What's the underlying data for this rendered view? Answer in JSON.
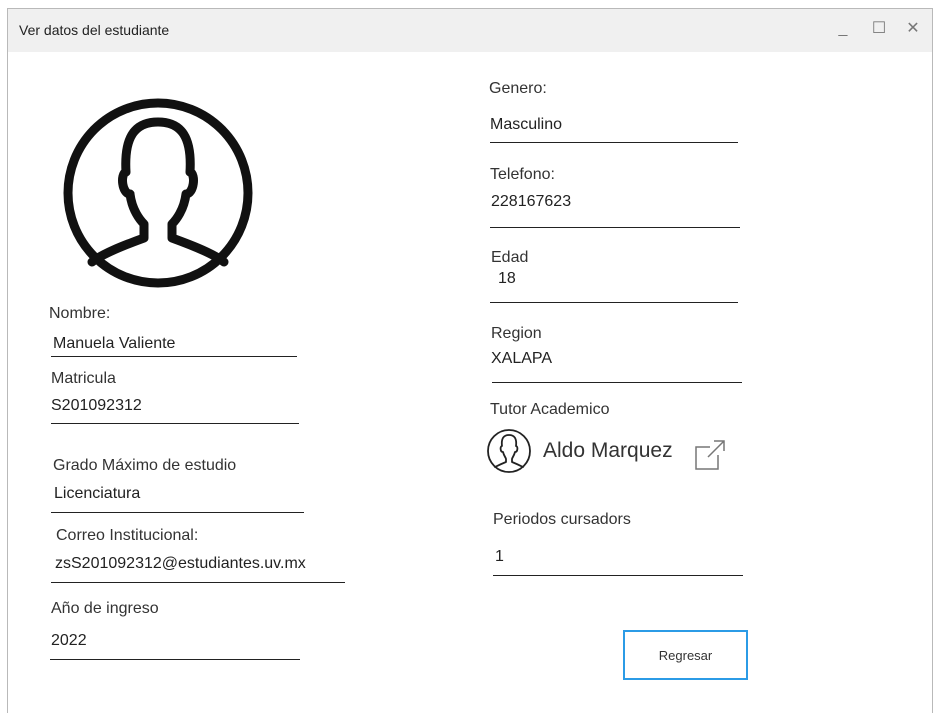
{
  "window": {
    "title": "Ver datos del estudiante",
    "minimize": "_",
    "maximize": "☐",
    "close": "✕"
  },
  "fields": {
    "nombre": {
      "label": "Nombre:",
      "value": "Manuela Valiente"
    },
    "matricula": {
      "label": "Matricula",
      "value": "S201092312"
    },
    "grado": {
      "label": "Grado Máximo de estudio",
      "value": "Licenciatura"
    },
    "correo": {
      "label": "Correo Institucional:",
      "value": "zsS201092312@estudiantes.uv.mx"
    },
    "anio": {
      "label": "Año de ingreso",
      "value": "2022"
    },
    "genero": {
      "label": "Genero:",
      "value": "Masculino"
    },
    "telefono": {
      "label": "Telefono:",
      "value": "228167623"
    },
    "edad": {
      "label": "Edad",
      "value": "18"
    },
    "region": {
      "label": "Region",
      "value": "XALAPA"
    },
    "tutor": {
      "label": "Tutor Academico",
      "value": "Aldo Marquez"
    },
    "periodos": {
      "label": "Periodos cursadors",
      "value": "1"
    }
  },
  "actions": {
    "back_label": "Regresar"
  },
  "icons": {
    "avatar": "user-avatar-icon",
    "tutor": "user-icon",
    "open": "external-link-icon"
  }
}
